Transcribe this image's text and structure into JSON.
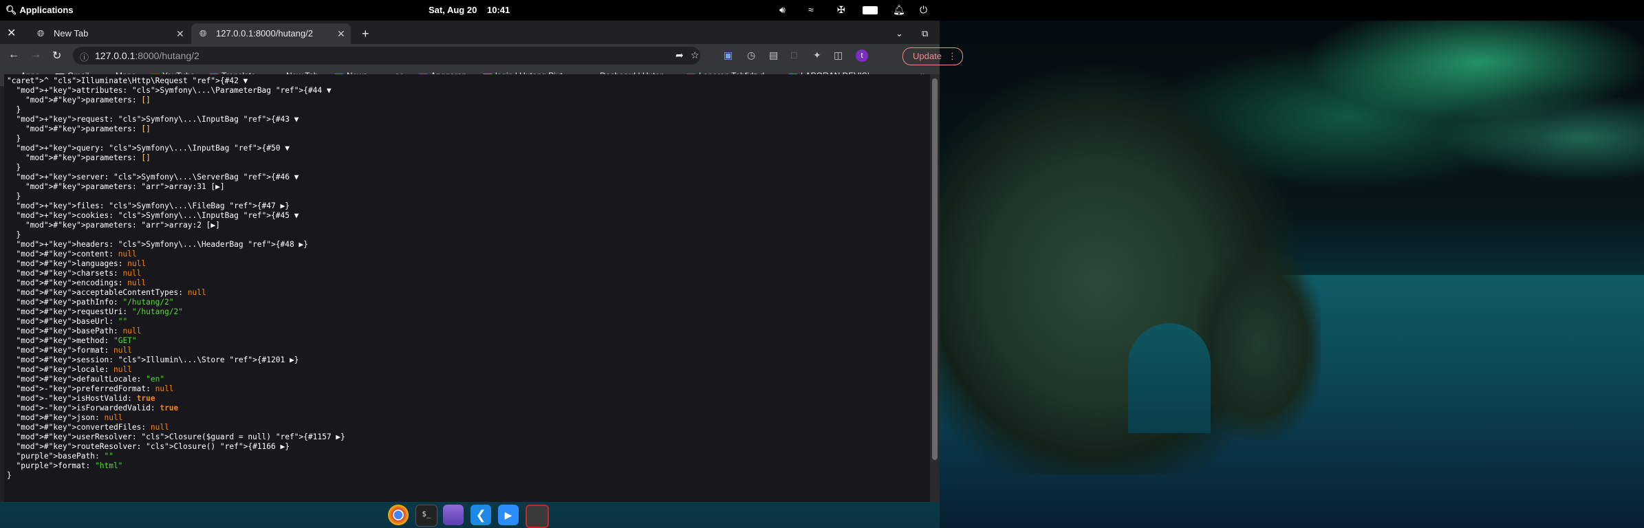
{
  "system_bar": {
    "apps_label": "Applications",
    "date": "Sat, Aug 20",
    "time": "10:41",
    "tray_icons": [
      "volume-icon",
      "wifi-icon",
      "bluetooth-icon",
      "battery-icon",
      "notification-icon",
      "power-icon"
    ]
  },
  "browser": {
    "tabs": [
      {
        "title": "New Tab",
        "active": false
      },
      {
        "title": "127.0.0.1:8000/hutang/2",
        "active": true
      }
    ],
    "new_tab_symbol": "+",
    "url_host": "127.0.0.1",
    "url_rest": ":8000/hutang/2",
    "update_label": "Update",
    "profile_initial": "t",
    "bookmarks": [
      {
        "label": "Apps",
        "icon": "apps-grid-icon"
      },
      {
        "label": "Gmail",
        "icon": "gmail-icon"
      },
      {
        "label": "Maps",
        "icon": "maps-icon"
      },
      {
        "label": "YouTube",
        "icon": "youtube-icon"
      },
      {
        "label": "Translate",
        "icon": "translate-icon"
      },
      {
        "label": "New Tab",
        "icon": "globe-icon"
      },
      {
        "label": "News",
        "icon": "news-icon"
      },
      {
        "label": "ee",
        "icon": "ee-icon"
      },
      {
        "label": "Anggaran",
        "icon": "anggaran-icon"
      },
      {
        "label": "login | Hutang Piut...",
        "icon": "login-icon"
      },
      {
        "label": "Dasboard | Hutan...",
        "icon": "globe-icon"
      },
      {
        "label": "Laporan Tahfidz d...",
        "icon": "sheets-icon"
      },
      {
        "label": "LAPORAN DEVISI...",
        "icon": "docs-icon"
      }
    ],
    "bookmarks_overflow": "»"
  },
  "dump": {
    "lines": [
      {
        "t": "^ Illuminate\\Http\\Request {#42 ▼"
      },
      {
        "t": "  +attributes: Symfony\\...\\ParameterBag {#44 ▼"
      },
      {
        "t": "    #parameters: []"
      },
      {
        "t": "  }"
      },
      {
        "t": "  +request: Symfony\\...\\InputBag {#43 ▼"
      },
      {
        "t": "    #parameters: []"
      },
      {
        "t": "  }"
      },
      {
        "t": "  +query: Symfony\\...\\InputBag {#50 ▼"
      },
      {
        "t": "    #parameters: []"
      },
      {
        "t": "  }"
      },
      {
        "t": "  +server: Symfony\\...\\ServerBag {#46 ▼"
      },
      {
        "t": "    #parameters: array:31 [▶]"
      },
      {
        "t": "  }"
      },
      {
        "t": "  +files: Symfony\\...\\FileBag {#47 ▶}"
      },
      {
        "t": "  +cookies: Symfony\\...\\InputBag {#45 ▼"
      },
      {
        "t": "    #parameters: array:2 [▶]"
      },
      {
        "t": "  }"
      },
      {
        "t": "  +headers: Symfony\\...\\HeaderBag {#48 ▶}"
      },
      {
        "t": "  #content: null"
      },
      {
        "t": "  #languages: null"
      },
      {
        "t": "  #charsets: null"
      },
      {
        "t": "  #encodings: null"
      },
      {
        "t": "  #acceptableContentTypes: null"
      },
      {
        "t": "  #pathInfo: \"/hutang/2\""
      },
      {
        "t": "  #requestUri: \"/hutang/2\""
      },
      {
        "t": "  #baseUrl: \"\""
      },
      {
        "t": "  #basePath: null"
      },
      {
        "t": "  #method: \"GET\""
      },
      {
        "t": "  #format: null"
      },
      {
        "t": "  #session: Illumin\\...\\Store {#1201 ▶}"
      },
      {
        "t": "  #locale: null"
      },
      {
        "t": "  #defaultLocale: \"en\""
      },
      {
        "t": "  -preferredFormat: null"
      },
      {
        "t": "  -isHostValid: true"
      },
      {
        "t": "  -isForwardedValid: true"
      },
      {
        "t": "  #json: null"
      },
      {
        "t": "  #convertedFiles: null"
      },
      {
        "t": "  #userResolver: Closure($guard = null) {#1157 ▶}"
      },
      {
        "t": "  #routeResolver: Closure() {#1166 ▶}"
      },
      {
        "t": "  basePath: \"\""
      },
      {
        "t": "  format: \"html\""
      },
      {
        "t": "}"
      }
    ]
  },
  "colors": {
    "dump_bg": "#18171b",
    "class": "#1299da",
    "string": "#56db3a",
    "null": "#ff8400",
    "modifier": "#ffd066"
  },
  "dock": [
    "chrome-icon",
    "terminal-icon",
    "store-icon",
    "vscode-icon",
    "zoom-icon",
    "screenshot-icon"
  ]
}
